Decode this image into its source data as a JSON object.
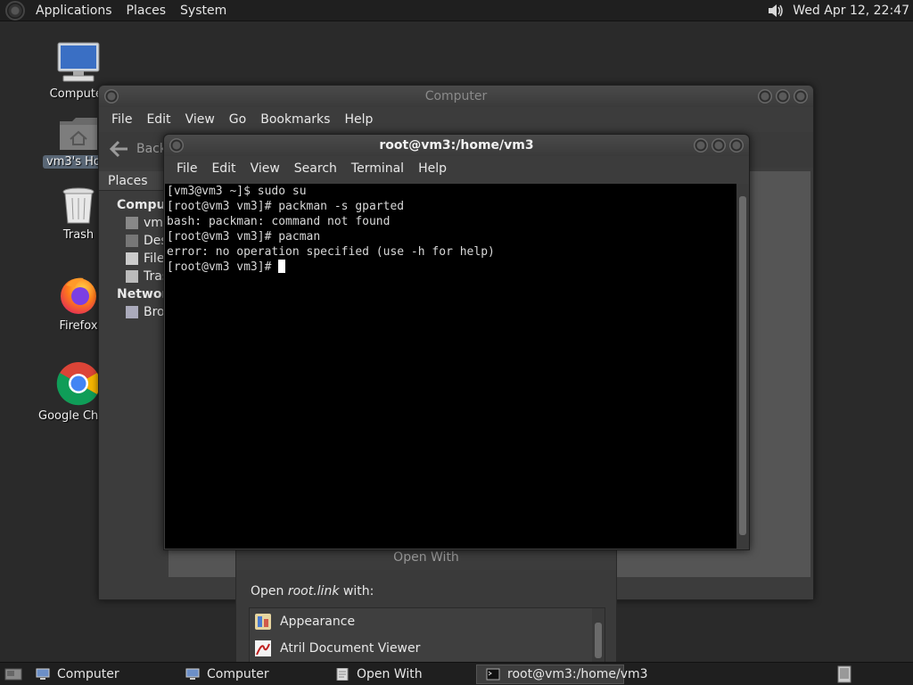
{
  "top_panel": {
    "menus": [
      "Applications",
      "Places",
      "System"
    ],
    "clock": "Wed Apr 12, 22:47"
  },
  "desktop": {
    "icons": [
      {
        "label": "Computer"
      },
      {
        "label": "vm3's Home"
      },
      {
        "label": "Trash"
      },
      {
        "label": "Firefox"
      },
      {
        "label": "Google Chrome"
      }
    ]
  },
  "file_manager": {
    "title": "Computer",
    "menus": [
      "File",
      "Edit",
      "View",
      "Go",
      "Bookmarks",
      "Help"
    ],
    "back_label": "Back",
    "sidebar": {
      "header": "Places",
      "computer_section": "Computer",
      "items": [
        "vm3",
        "Desktop",
        "File System",
        "Trash"
      ],
      "network_section": "Network",
      "network_items": [
        "Browse Network"
      ]
    }
  },
  "open_with": {
    "title": "Open With",
    "prompt_prefix": "Open ",
    "prompt_file": "root.link",
    "prompt_suffix": " with:",
    "apps": [
      "Appearance",
      "Atril Document Viewer"
    ]
  },
  "terminal": {
    "title": "root@vm3:/home/vm3",
    "menus": [
      "File",
      "Edit",
      "View",
      "Search",
      "Terminal",
      "Help"
    ],
    "lines": [
      "[vm3@vm3 ~]$ sudo su",
      "[root@vm3 vm3]# packman -s gparted",
      "bash: packman: command not found",
      "[root@vm3 vm3]# pacman",
      "error: no operation specified (use -h for help)",
      "[root@vm3 vm3]# "
    ]
  },
  "taskbar": {
    "tasks": [
      "Computer",
      "Computer",
      "Open With",
      "root@vm3:/home/vm3"
    ]
  }
}
